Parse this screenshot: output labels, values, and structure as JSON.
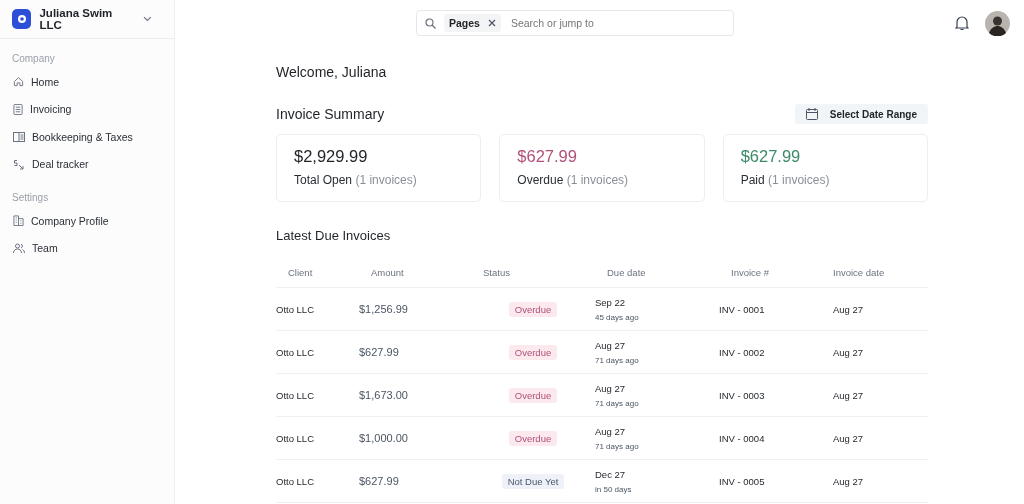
{
  "sidebar": {
    "company": "Juliana Swim LLC",
    "sections": [
      {
        "title": "Company",
        "items": [
          {
            "label": "Home"
          },
          {
            "label": "Invoicing"
          },
          {
            "label": "Bookkeeping & Taxes"
          },
          {
            "label": "Deal tracker"
          }
        ]
      },
      {
        "title": "Settings",
        "items": [
          {
            "label": "Company Profile"
          },
          {
            "label": "Team"
          }
        ]
      }
    ]
  },
  "search": {
    "chip": "Pages",
    "placeholder": "Search or jump to"
  },
  "welcome": "Welcome, Juliana",
  "summary": {
    "title": "Invoice Summary",
    "date_button": "Select Date Range",
    "cards": [
      {
        "amount": "$2,929.99",
        "color": "#1f2328",
        "label": "Total Open",
        "count": "(1 invoices)"
      },
      {
        "amount": "$627.99",
        "color": "#b0517a",
        "label": "Overdue",
        "count": "(1 invoices)"
      },
      {
        "amount": "$627.99",
        "color": "#3d8a68",
        "label": "Paid",
        "count": "(1 invoices)"
      }
    ]
  },
  "invoices": {
    "title": "Latest Due Invoices",
    "columns": [
      "Client",
      "Amount",
      "Status",
      "Due date",
      "Invoice #",
      "Invoice date"
    ],
    "rows": [
      {
        "client": "Otto LLC",
        "amount": "$1,256.99",
        "status": {
          "kind": "overdue",
          "label": "Overdue"
        },
        "due": "Sep 22",
        "relative": "45 days ago",
        "number": "INV - 0001",
        "date": "Aug 27"
      },
      {
        "client": "Otto LLC",
        "amount": "$627.99",
        "status": {
          "kind": "overdue",
          "label": "Overdue"
        },
        "due": "Aug 27",
        "relative": "71 days ago",
        "number": "INV - 0002",
        "date": "Aug 27"
      },
      {
        "client": "Otto LLC",
        "amount": "$1,673.00",
        "status": {
          "kind": "overdue",
          "label": "Overdue"
        },
        "due": "Aug 27",
        "relative": "71 days ago",
        "number": "INV - 0003",
        "date": "Aug 27"
      },
      {
        "client": "Otto LLC",
        "amount": "$1,000.00",
        "status": {
          "kind": "overdue",
          "label": "Overdue"
        },
        "due": "Aug 27",
        "relative": "71 days ago",
        "number": "INV - 0004",
        "date": "Aug 27"
      },
      {
        "client": "Otto LLC",
        "amount": "$627.99",
        "status": {
          "kind": "notdue",
          "label": "Not Due Yet"
        },
        "due": "Dec 27",
        "relative": "in 50 days",
        "number": "INV - 0005",
        "date": "Aug 27"
      }
    ]
  }
}
